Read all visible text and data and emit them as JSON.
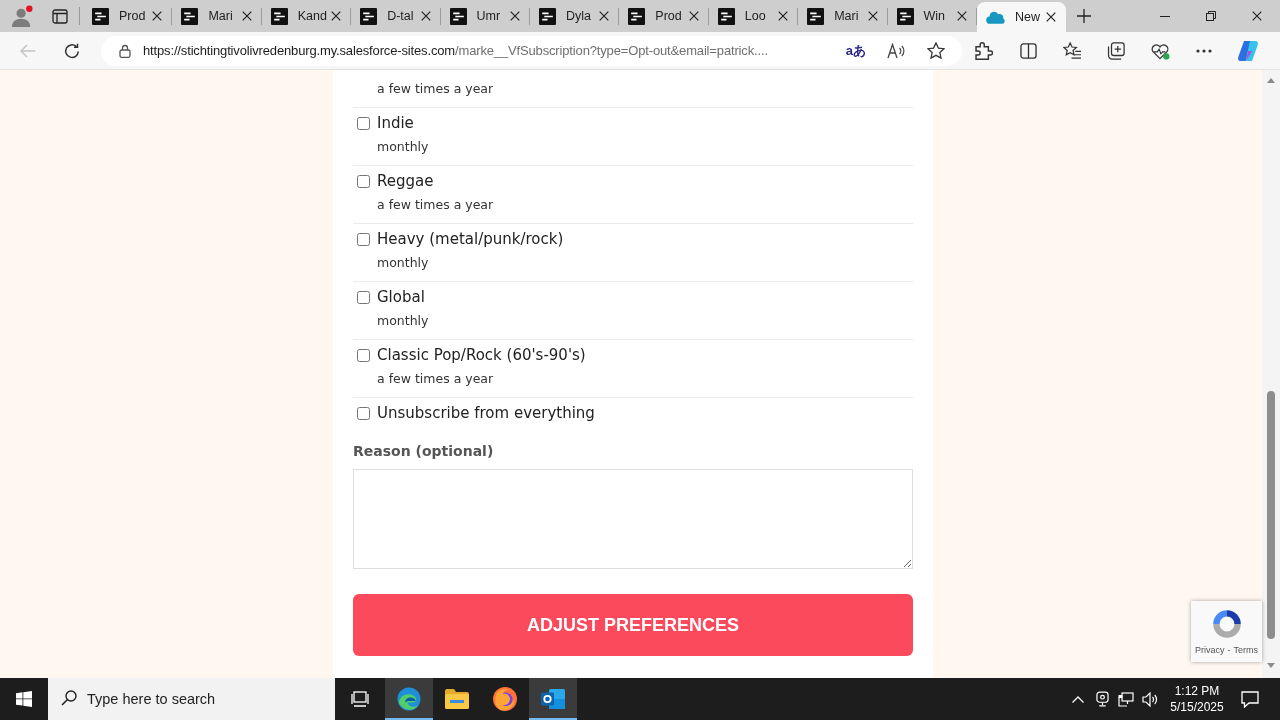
{
  "browser": {
    "tabs": [
      {
        "title": "Prod",
        "kind": "page",
        "selected": false
      },
      {
        "title": "Mari",
        "kind": "page",
        "selected": false
      },
      {
        "title": "Kand",
        "kind": "page",
        "selected": false
      },
      {
        "title": "D-tal",
        "kind": "page",
        "selected": false
      },
      {
        "title": "Umr",
        "kind": "page",
        "selected": false
      },
      {
        "title": "Dyla",
        "kind": "page",
        "selected": false
      },
      {
        "title": "Prod",
        "kind": "page",
        "selected": false
      },
      {
        "title": "Loo",
        "kind": "page",
        "selected": false
      },
      {
        "title": "Mari",
        "kind": "page",
        "selected": false
      },
      {
        "title": "Win",
        "kind": "page",
        "selected": false
      },
      {
        "title": "New",
        "kind": "cloud",
        "selected": true
      }
    ],
    "address_bar": {
      "host": "https://stichtingtivolivredenburg.my.salesforce-sites.com",
      "path": "/marke__VfSubscription?type=Opt-out&email=patrick....",
      "translate": "aあ"
    }
  },
  "form": {
    "options": [
      {
        "frequency": "a few times a year"
      },
      {
        "label": "Indie",
        "frequency": "monthly",
        "checked": false
      },
      {
        "label": "Reggae",
        "frequency": "a few times a year",
        "checked": false
      },
      {
        "label": "Heavy (metal/punk/rock)",
        "frequency": "monthly",
        "checked": false
      },
      {
        "label": "Global",
        "frequency": "monthly",
        "checked": false
      },
      {
        "label": "Classic Pop/Rock (60's-90's)",
        "frequency": "a few times a year",
        "checked": false
      },
      {
        "label": "Unsubscribe from everything",
        "checked": false
      }
    ],
    "reason_label": "Reason (optional)",
    "submit": "ADJUST PREFERENCES"
  },
  "recaptcha": {
    "privacy": "Privacy",
    "separator": "-",
    "terms": "Terms"
  },
  "taskbar": {
    "search": {
      "placeholder": "Type here to search"
    },
    "apps": [
      {
        "kind": "edge",
        "open": true
      },
      {
        "kind": "explorer",
        "open": false
      },
      {
        "kind": "firefox",
        "open": false
      },
      {
        "kind": "outlook",
        "open": true
      }
    ],
    "time": "1:12 PM",
    "date": "5/15/2025"
  }
}
